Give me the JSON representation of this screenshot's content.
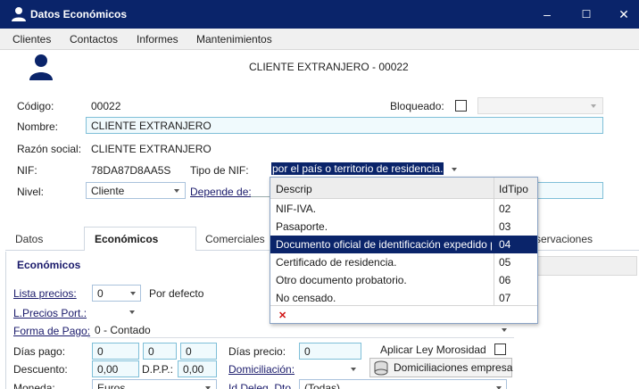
{
  "window": {
    "title": "Datos Económicos",
    "minimize": "–",
    "maximize": "☐",
    "close": "✕"
  },
  "menu": [
    "Clientes",
    "Contactos",
    "Informes",
    "Mantenimientos"
  ],
  "header": {
    "client_title": "CLIENTE EXTRANJERO - 00022"
  },
  "form": {
    "codigo_label": "Código:",
    "codigo_value": "00022",
    "bloqueado_label": "Bloqueado:",
    "nombre_label": "Nombre:",
    "nombre_value": "CLIENTE EXTRANJERO",
    "razon_label": "Razón social:",
    "razon_value": "CLIENTE EXTRANJERO",
    "nif_label": "NIF:",
    "nif_value": "78DA87D8AA5S",
    "tipo_nif_label": "Tipo de NIF:",
    "tipo_nif_value": "por el país o territorio de residencia.",
    "nivel_label": "Nivel:",
    "nivel_value": "Cliente",
    "depende_label": "Depende de:"
  },
  "tabs": [
    "Datos",
    "Económicos",
    "Comerciales",
    "servaciones"
  ],
  "economicos": {
    "section_title": "Económicos",
    "lista_precios_label": "Lista precios:",
    "lista_precios_value": "0",
    "por_defecto": "Por defecto",
    "lprecios_port_label": "L.Precios Port.:",
    "forma_pago_label": "Forma de Pago:",
    "forma_pago_value": "0 - Contado",
    "dias_pago_label": "Días pago:",
    "dias_pago_values": [
      "0",
      "0",
      "0"
    ],
    "dias_precio_label": "Días precio:",
    "dias_precio_value": "0",
    "ley_morosidad_label": "Aplicar Ley Morosidad",
    "descuento_label": "Descuento:",
    "descuento_value": "0,00",
    "dpp_label": "D.P.P.:",
    "dpp_value": "0,00",
    "domiciliacion_label": "Domiciliación:",
    "domiciliaciones_btn": "Domiciliaciones empresa",
    "moneda_label": "Moneda:",
    "moneda_value": "Euros",
    "id_deleg_label": "Id.Deleg. Dto.",
    "id_deleg_value": "(Todas)"
  },
  "dropdown": {
    "col_descrip": "Descrip",
    "col_idtipo": "IdTipo",
    "rows": [
      {
        "descrip": "NIF-IVA.",
        "id": "02"
      },
      {
        "descrip": "Pasaporte.",
        "id": "03"
      },
      {
        "descrip": "Documento oficial de identificación expedido por el país",
        "id": "04",
        "selected": true
      },
      {
        "descrip": "Certificado de residencia.",
        "id": "05"
      },
      {
        "descrip": "Otro documento probatorio.",
        "id": "06"
      },
      {
        "descrip": "No censado.",
        "id": "07"
      }
    ],
    "clear_icon": "✕"
  },
  "colors": {
    "titlebar": "#0a246a",
    "selection": "#0a246a",
    "accent_border": "#7fbfd8"
  }
}
